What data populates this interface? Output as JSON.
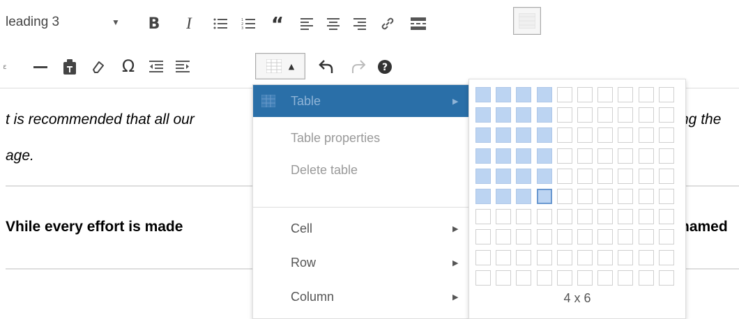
{
  "toolbar": {
    "format_select": "leading 3",
    "row1_icons": [
      "dropdown-arrow",
      "bold",
      "italic",
      "bulleted-list",
      "numbered-list",
      "blockquote",
      "align-left",
      "align-center",
      "align-right",
      "link",
      "read-more",
      "toolbar-toggle"
    ],
    "row2_icons": [
      "text-color",
      "horizontal-line",
      "paste-text",
      "clear-formatting",
      "special-character",
      "outdent",
      "indent",
      "table",
      "undo",
      "redo",
      "help"
    ]
  },
  "content": {
    "para1_start": "t is recommended that all our",
    "para1_end": "ng the",
    "para1_line2": "age.",
    "para2_start": "Vhile every effort is made",
    "para2_end": "named"
  },
  "table_menu": {
    "items": [
      {
        "label": "Table",
        "state": "selected",
        "submenu": true
      },
      {
        "label": "Table properties",
        "state": "disabled",
        "submenu": false
      },
      {
        "label": "Delete table",
        "state": "disabled",
        "submenu": false
      },
      {
        "label": "Cell",
        "state": "normal",
        "submenu": true
      },
      {
        "label": "Row",
        "state": "normal",
        "submenu": true
      },
      {
        "label": "Column",
        "state": "normal",
        "submenu": true
      }
    ]
  },
  "table_grid": {
    "columns": 10,
    "rows": 10,
    "selected_cols": 4,
    "selected_rows": 6,
    "size_label": "4 x 6"
  },
  "colors": {
    "selected_menu_bg": "#2a6fa8",
    "grid_highlight": "#bcd4f2"
  }
}
